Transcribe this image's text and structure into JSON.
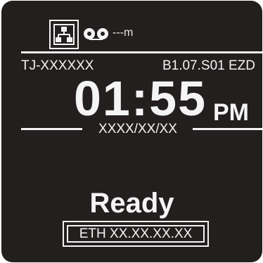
{
  "status_bar": {
    "network_icon": "network-icon",
    "ribbon_icon": "ribbon-icon",
    "ribbon_remaining": "---m"
  },
  "info": {
    "model": "TJ-XXXXXX",
    "firmware": "B1.07.S01 EZD"
  },
  "clock": {
    "time": "01:55",
    "ampm": "PM",
    "date": "XXXX/XX/XX"
  },
  "printer_status": {
    "label": "Ready"
  },
  "network": {
    "address": "ETH XX.XX.XX.XX"
  },
  "colors": {
    "screen_background": "#231f1e",
    "foreground": "#f4f4f4"
  }
}
